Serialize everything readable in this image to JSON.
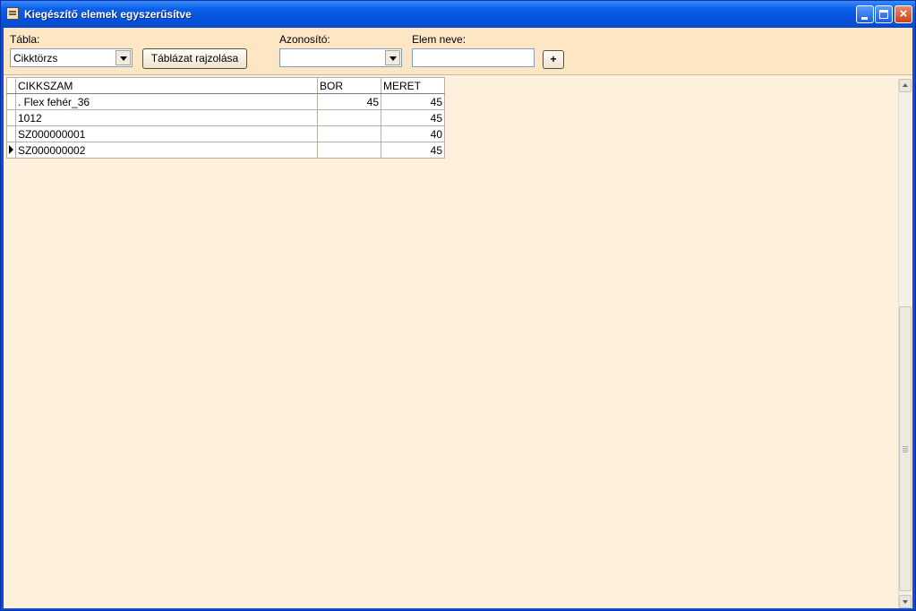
{
  "window": {
    "title": "Kiegészítő elemek egyszerűsítve",
    "buttons": {
      "close": "×"
    }
  },
  "toolbar": {
    "table_label": "Tábla:",
    "table_value": "Cikktörzs",
    "draw_button": "Táblázat rajzolása",
    "id_label": "Azonosító:",
    "id_value": "",
    "name_label": "Elem neve:",
    "name_value": "",
    "add_button": "+"
  },
  "grid": {
    "columns": [
      "CIKKSZAM",
      "BOR",
      "MERET"
    ],
    "rows": [
      {
        "cikkszam": ". Flex fehér_36",
        "bor": "45",
        "meret": "45"
      },
      {
        "cikkszam": "1012",
        "bor": "",
        "meret": "45"
      },
      {
        "cikkszam": "SZ000000001",
        "bor": "",
        "meret": "40"
      },
      {
        "cikkszam": "SZ000000002",
        "bor": "",
        "meret": "45"
      }
    ]
  }
}
